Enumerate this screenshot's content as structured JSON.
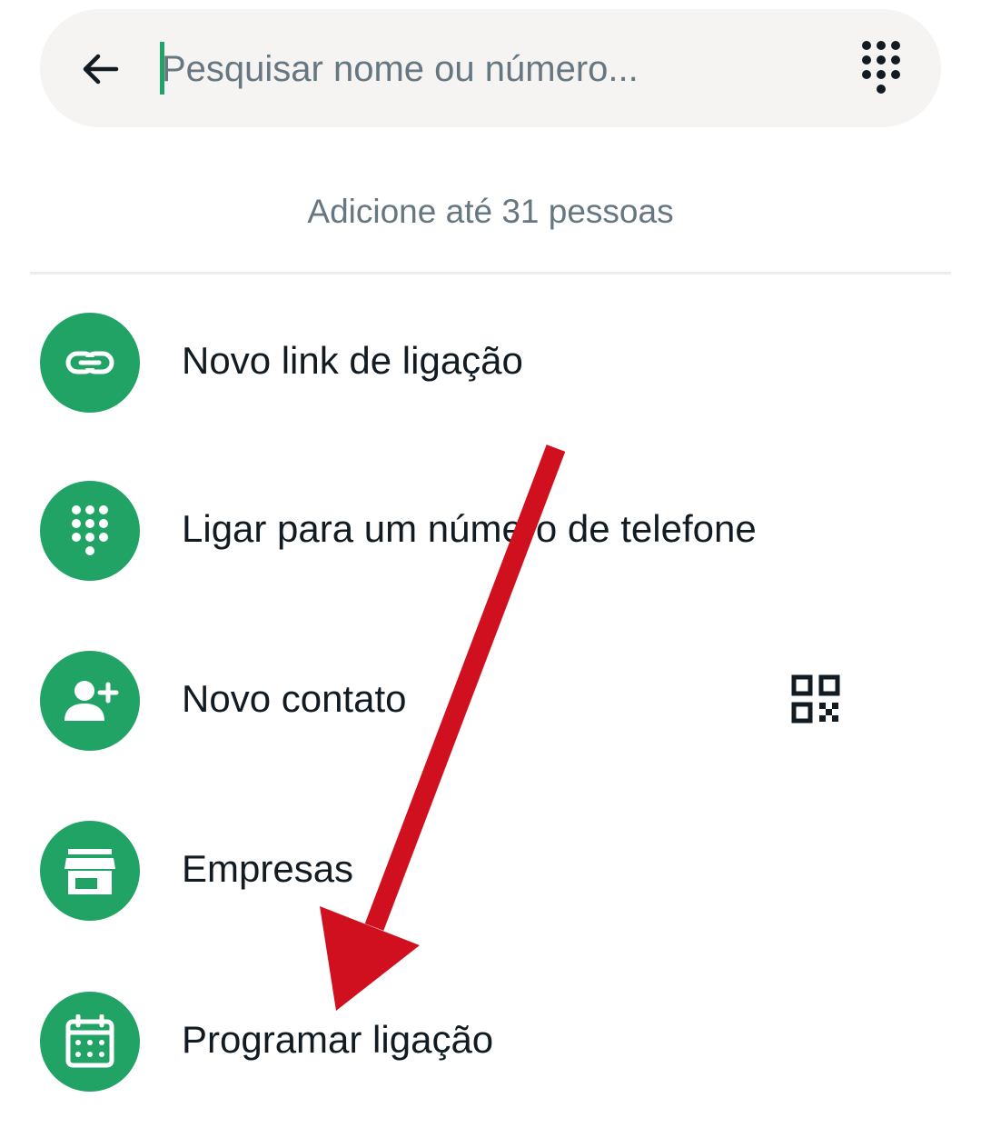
{
  "search": {
    "placeholder": "Pesquisar nome ou número...",
    "value": ""
  },
  "hint": "Adicione até 31 pessoas",
  "menu": {
    "items": [
      {
        "label": "Novo link de ligação",
        "icon": "link-icon"
      },
      {
        "label": "Ligar para um número de telefone",
        "icon": "dialpad-icon"
      },
      {
        "label": "Novo contato",
        "icon": "person-add-icon",
        "trailing_icon": "qr-code-icon"
      },
      {
        "label": "Empresas",
        "icon": "storefront-icon"
      },
      {
        "label": "Programar ligação",
        "icon": "calendar-icon"
      }
    ]
  },
  "colors": {
    "accent": "#21a366",
    "search_bg": "#f5f4f2",
    "secondary_text": "#667781",
    "primary_text": "#111b21",
    "annotation_arrow": "#d0101f"
  }
}
